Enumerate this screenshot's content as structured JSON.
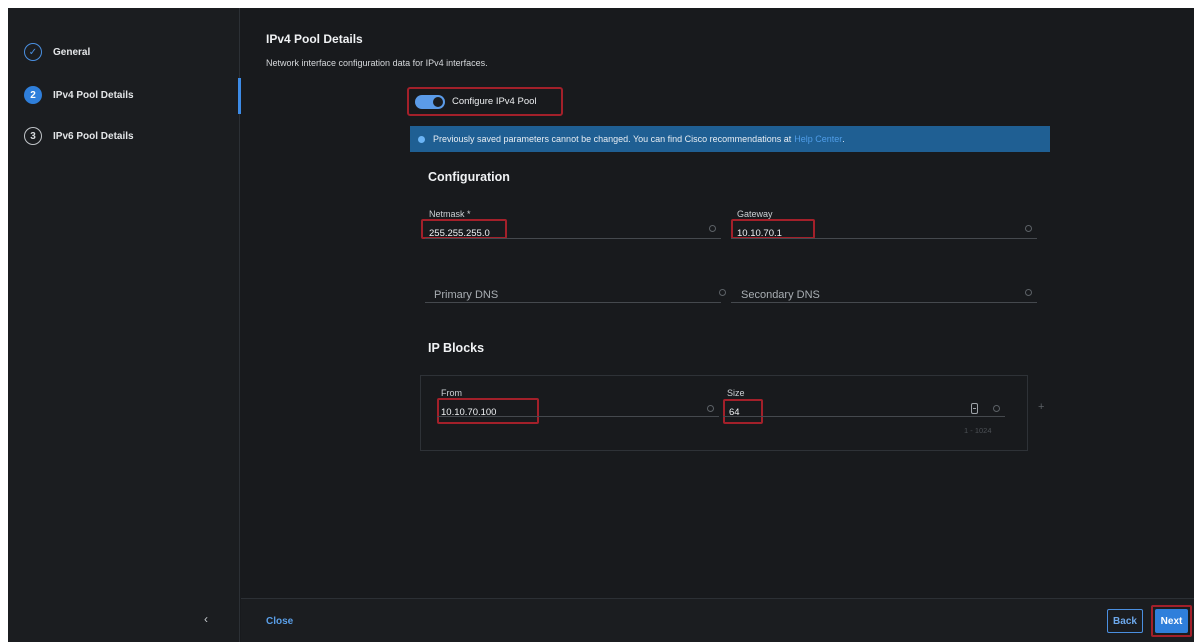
{
  "sidebar": {
    "steps": [
      {
        "badge": "✓",
        "label": "General"
      },
      {
        "badge": "2",
        "label": "IPv4 Pool Details"
      },
      {
        "badge": "3",
        "label": "IPv6 Pool Details"
      }
    ],
    "collapse_glyph": "‹"
  },
  "page": {
    "title": "IPv4 Pool Details",
    "subtitle": "Network interface configuration data for IPv4 interfaces."
  },
  "toggle": {
    "label": "Configure IPv4 Pool",
    "on": true
  },
  "banner": {
    "text": "Previously saved parameters cannot be changed. You can find Cisco recommendations at",
    "link": "Help Center",
    "tail": "."
  },
  "configuration": {
    "heading": "Configuration",
    "netmask": {
      "label": "Netmask *",
      "value": "255.255.255.0"
    },
    "gateway": {
      "label": "Gateway",
      "value": "10.10.70.1"
    },
    "primary_dns": {
      "placeholder": "Primary DNS"
    },
    "secondary_dns": {
      "placeholder": "Secondary DNS"
    }
  },
  "ip_blocks": {
    "heading": "IP Blocks",
    "from": {
      "label": "From",
      "value": "10.10.70.100"
    },
    "size": {
      "label": "Size",
      "value": "64",
      "hint": "1 - 1024"
    },
    "add_glyph": "+"
  },
  "footer": {
    "close_label": "Close",
    "back_label": "Back",
    "next_label": "Next"
  },
  "colors": {
    "accent": "#2f7fdb",
    "highlight": "#a3202a",
    "banner": "#1f5f93"
  },
  "icons": [
    "check-circle-icon",
    "info-icon",
    "stepper-icon",
    "add-icon",
    "chevron-left-icon"
  ]
}
